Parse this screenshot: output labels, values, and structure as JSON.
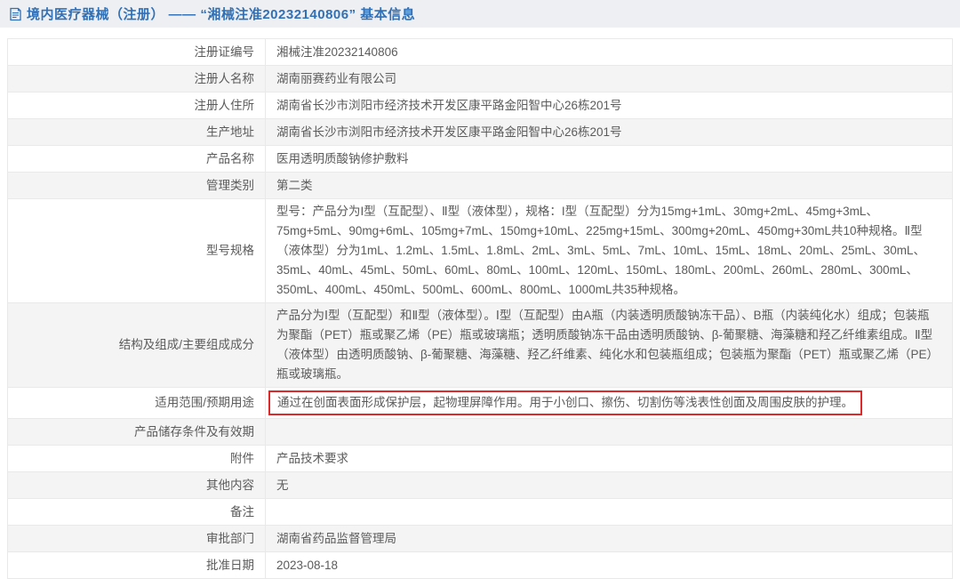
{
  "header": {
    "title": "境内医疗器械（注册） —— “湘械注准20232140806” 基本信息"
  },
  "colors": {
    "title_text": "#3270b5",
    "title_bar_bg": "#edeff3",
    "row_alt_bg": "#f4f4f4",
    "border": "#e9e9e9",
    "highlight_border": "#dc2a2a",
    "body_text": "#5b5b5b"
  },
  "table": {
    "rows": [
      {
        "label": "注册证编号",
        "value": "湘械注准20232140806"
      },
      {
        "label": "注册人名称",
        "value": "湖南丽赛药业有限公司"
      },
      {
        "label": "注册人住所",
        "value": "湖南省长沙市浏阳市经济技术开发区康平路金阳智中心26栋201号"
      },
      {
        "label": "生产地址",
        "value": "湖南省长沙市浏阳市经济技术开发区康平路金阳智中心26栋201号"
      },
      {
        "label": "产品名称",
        "value": "医用透明质酸钠修护敷料"
      },
      {
        "label": "管理类别",
        "value": "第二类"
      },
      {
        "label": "型号规格",
        "value": "型号：产品分为I型（互配型）、Ⅱ型（液体型），规格：I型（互配型）分为15mg+1mL、30mg+2mL、45mg+3mL、75mg+5mL、90mg+6mL、105mg+7mL、150mg+10mL、225mg+15mL、300mg+20mL、450mg+30mL共10种规格。Ⅱ型（液体型）分为1mL、1.2mL、1.5mL、1.8mL、2mL、3mL、5mL、7mL、10mL、15mL、18mL、20mL、25mL、30mL、35mL、40mL、45mL、50mL、60mL、80mL、100mL、120mL、150mL、180mL、200mL、260mL、280mL、300mL、350mL、400mL、450mL、500mL、600mL、800mL、1000mL共35种规格。"
      },
      {
        "label": "结构及组成/主要组成成分",
        "value": "产品分为Ⅰ型（互配型）和Ⅱ型（液体型）。Ⅰ型（互配型）由A瓶（内装透明质酸钠冻干品）、B瓶（内装纯化水）组成；包装瓶为聚酯（PET）瓶或聚乙烯（PE）瓶或玻璃瓶；透明质酸钠冻干品由透明质酸钠、β-葡聚糖、海藻糖和羟乙纤维素组成。Ⅱ型（液体型）由透明质酸钠、β-葡聚糖、海藻糖、羟乙纤维素、纯化水和包装瓶组成；包装瓶为聚酯（PET）瓶或聚乙烯（PE）瓶或玻璃瓶。"
      },
      {
        "label": "适用范围/预期用途",
        "value": "通过在创面表面形成保护层，起物理屏障作用。用于小创口、擦伤、切割伤等浅表性创面及周围皮肤的护理。"
      },
      {
        "label": "产品储存条件及有效期",
        "value": ""
      },
      {
        "label": "附件",
        "value": "产品技术要求"
      },
      {
        "label": "其他内容",
        "value": "无"
      },
      {
        "label": "备注",
        "value": ""
      },
      {
        "label": "审批部门",
        "value": "湖南省药品监督管理局"
      },
      {
        "label": "批准日期",
        "value": "2023-08-18"
      }
    ]
  }
}
